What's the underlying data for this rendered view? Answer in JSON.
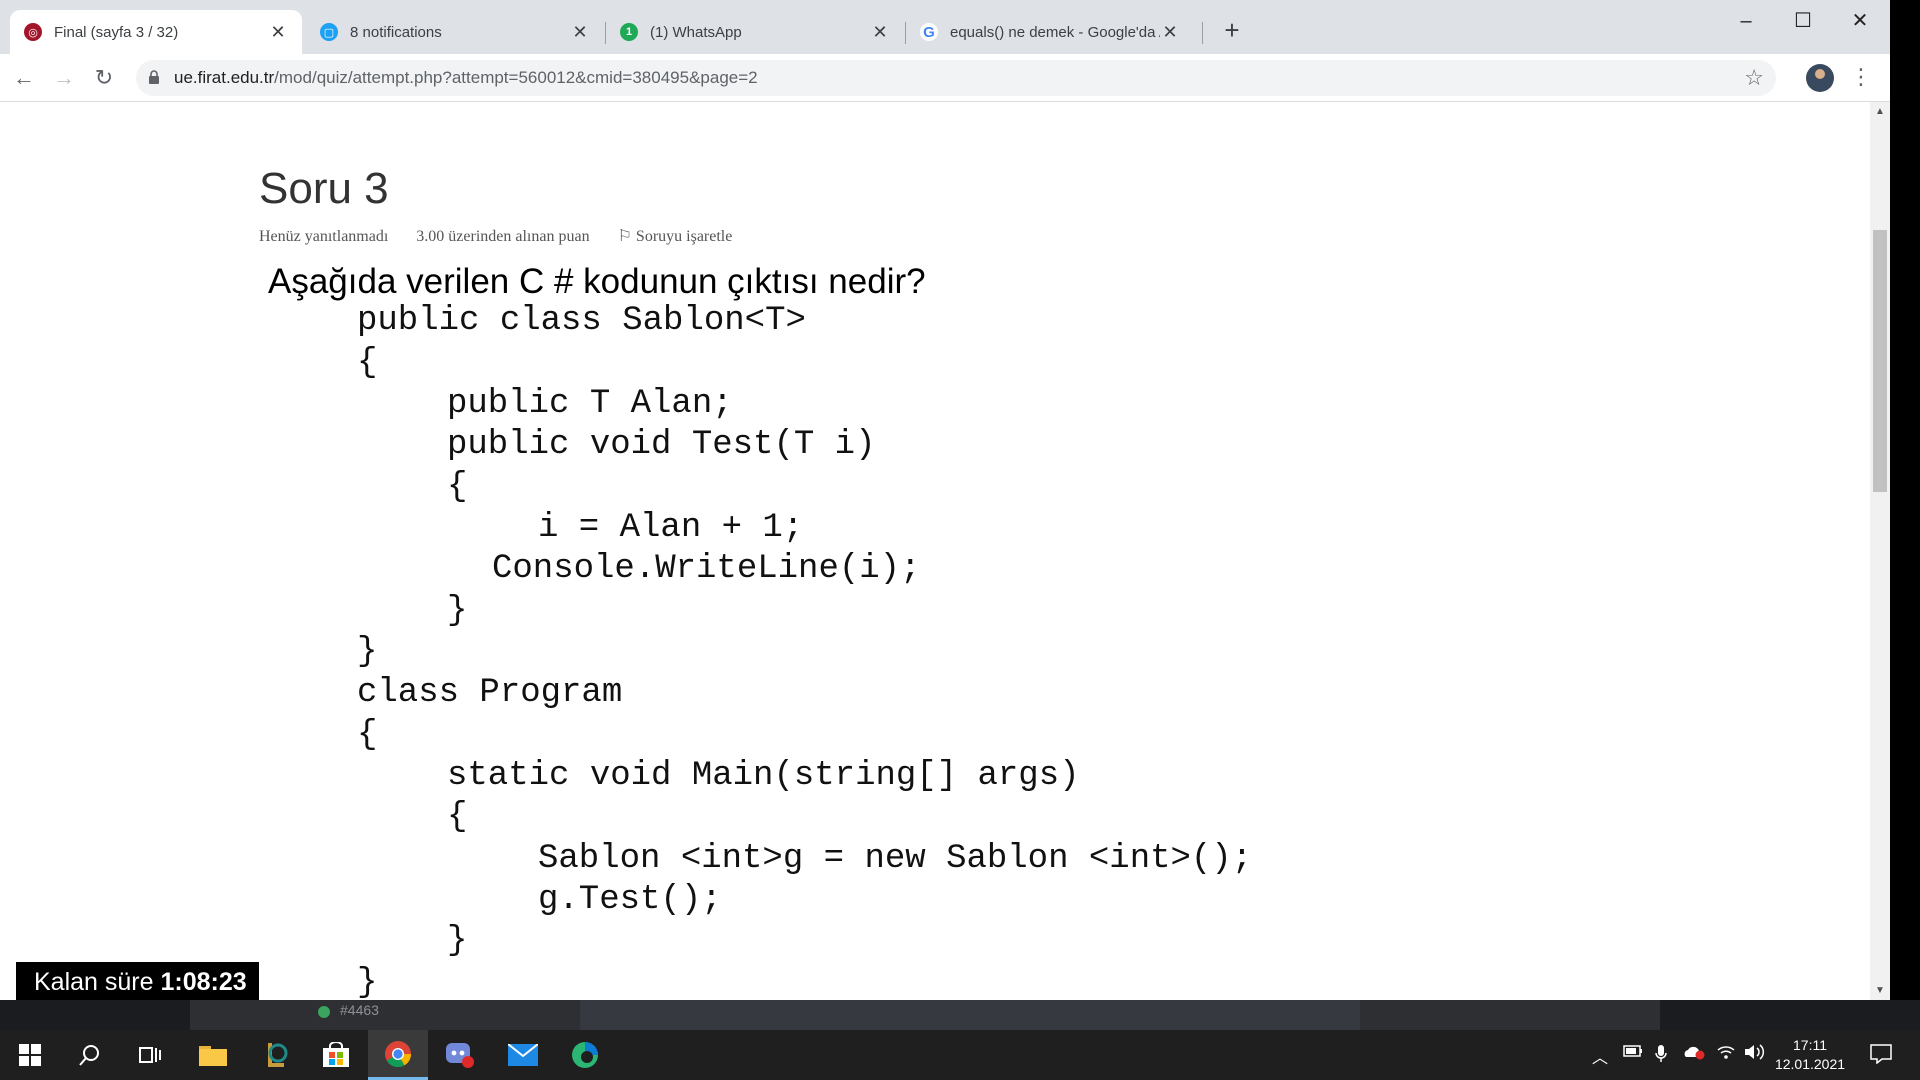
{
  "browser": {
    "tabs": [
      {
        "title": "Final (sayfa 3 / 32)",
        "favicon": "moodle-icon",
        "active": true
      },
      {
        "title": "8 notifications",
        "favicon": "chat-icon",
        "active": false
      },
      {
        "title": "(1) WhatsApp",
        "favicon": "whatsapp-icon",
        "active": false
      },
      {
        "title": "equals() ne demek - Google'da A",
        "favicon": "google-icon",
        "active": false
      }
    ],
    "new_tab": "+",
    "url_host": "ue.firat.edu.tr",
    "url_path": "/mod/quiz/attempt.php?attempt=560012&cmid=380495&page=2"
  },
  "question": {
    "title": "Soru 3",
    "status": "Henüz yanıtlanmadı",
    "points": "3.00 üzerinden alınan puan",
    "flag_label": "Soruyu işaretle",
    "text": "Aşağıda verilen C # kodunun çıktısı nedir?",
    "code": [
      "public class Sablon<T>",
      "{",
      "public T Alan;",
      "public void Test(T i)",
      "{",
      "i = Alan + 1;",
      "Console.WriteLine(i);",
      "}",
      "}",
      "class Program",
      "{",
      "static void Main(string[] args)",
      "{",
      "Sablon <int>g = new Sablon <int>();",
      "g.Test();",
      "}",
      "}"
    ]
  },
  "timer": {
    "label": "Kalan süre",
    "value": "1:08:23"
  },
  "underlay": {
    "tag": "#4463"
  },
  "clock": {
    "time": "17:11",
    "date": "12.01.2021"
  },
  "colors": {
    "accent": "#1a73e8",
    "timer_bg": "#000000"
  }
}
